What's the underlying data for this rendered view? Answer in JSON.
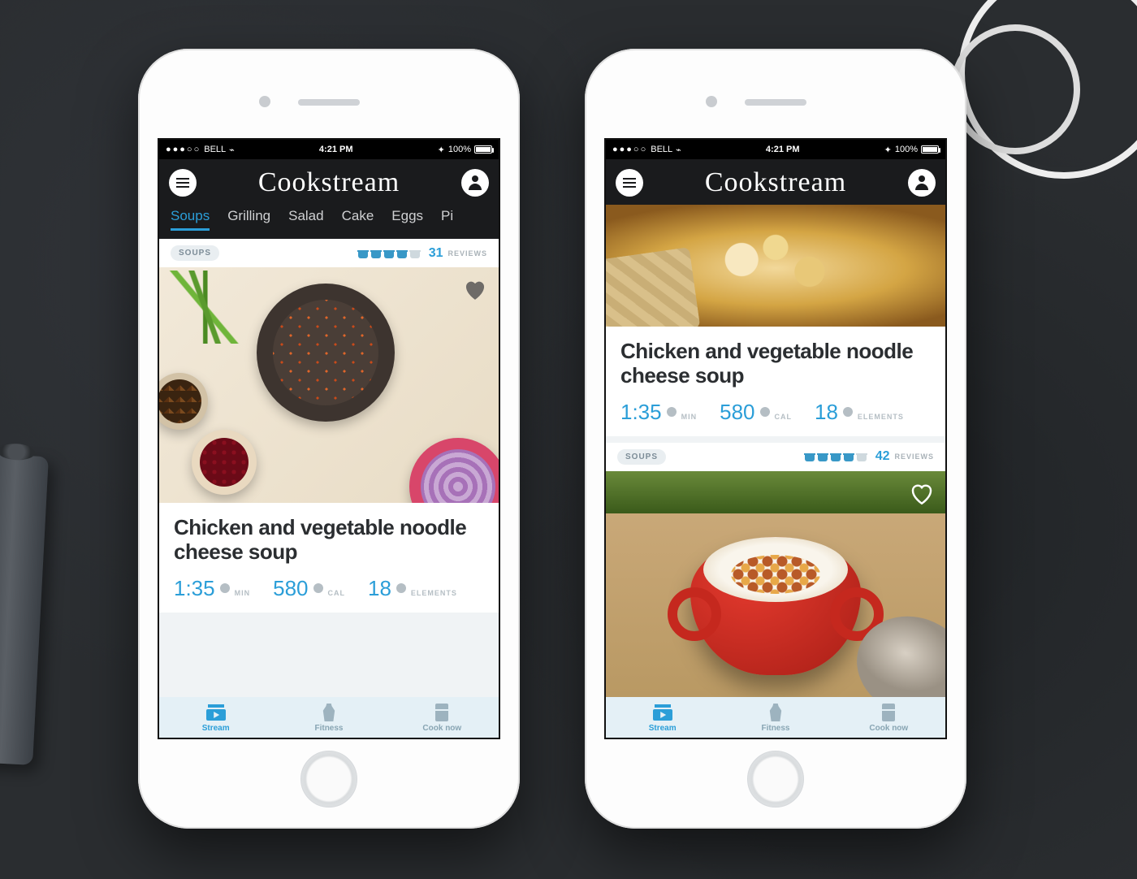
{
  "statusbar": {
    "carrier": "BELL",
    "time": "4:21 PM",
    "battery": "100%"
  },
  "app": {
    "title": "Cookstream"
  },
  "categories": [
    "Soups",
    "Grilling",
    "Salad",
    "Cake",
    "Eggs",
    "Pi"
  ],
  "active_category": "Soups",
  "bottom_nav": {
    "items": [
      {
        "label": "Stream",
        "active": true
      },
      {
        "label": "Fitness",
        "active": false
      },
      {
        "label": "Cook now",
        "active": false
      }
    ]
  },
  "left_phone": {
    "card": {
      "chip": "SOUPS",
      "rating_pots": 4,
      "rating_max": 5,
      "reviews_count": 31,
      "reviews_label": "REVIEWS",
      "title": "Chicken and vegetable noodle cheese soup",
      "stats": {
        "time_value": "1:35",
        "time_unit": "MIN",
        "cal_value": "580",
        "cal_unit": "CAL",
        "elem_value": "18",
        "elem_unit": "ELEMENTS"
      },
      "favorited": true
    }
  },
  "right_phone": {
    "top_card": {
      "title": "Chicken and vegetable noodle cheese soup",
      "stats": {
        "time_value": "1:35",
        "time_unit": "MIN",
        "cal_value": "580",
        "cal_unit": "CAL",
        "elem_value": "18",
        "elem_unit": "ELEMENTS"
      }
    },
    "bottom_card": {
      "chip": "SOUPS",
      "rating_pots": 4,
      "rating_max": 5,
      "reviews_count": 42,
      "reviews_label": "REVIEWS",
      "favorited": false
    }
  }
}
